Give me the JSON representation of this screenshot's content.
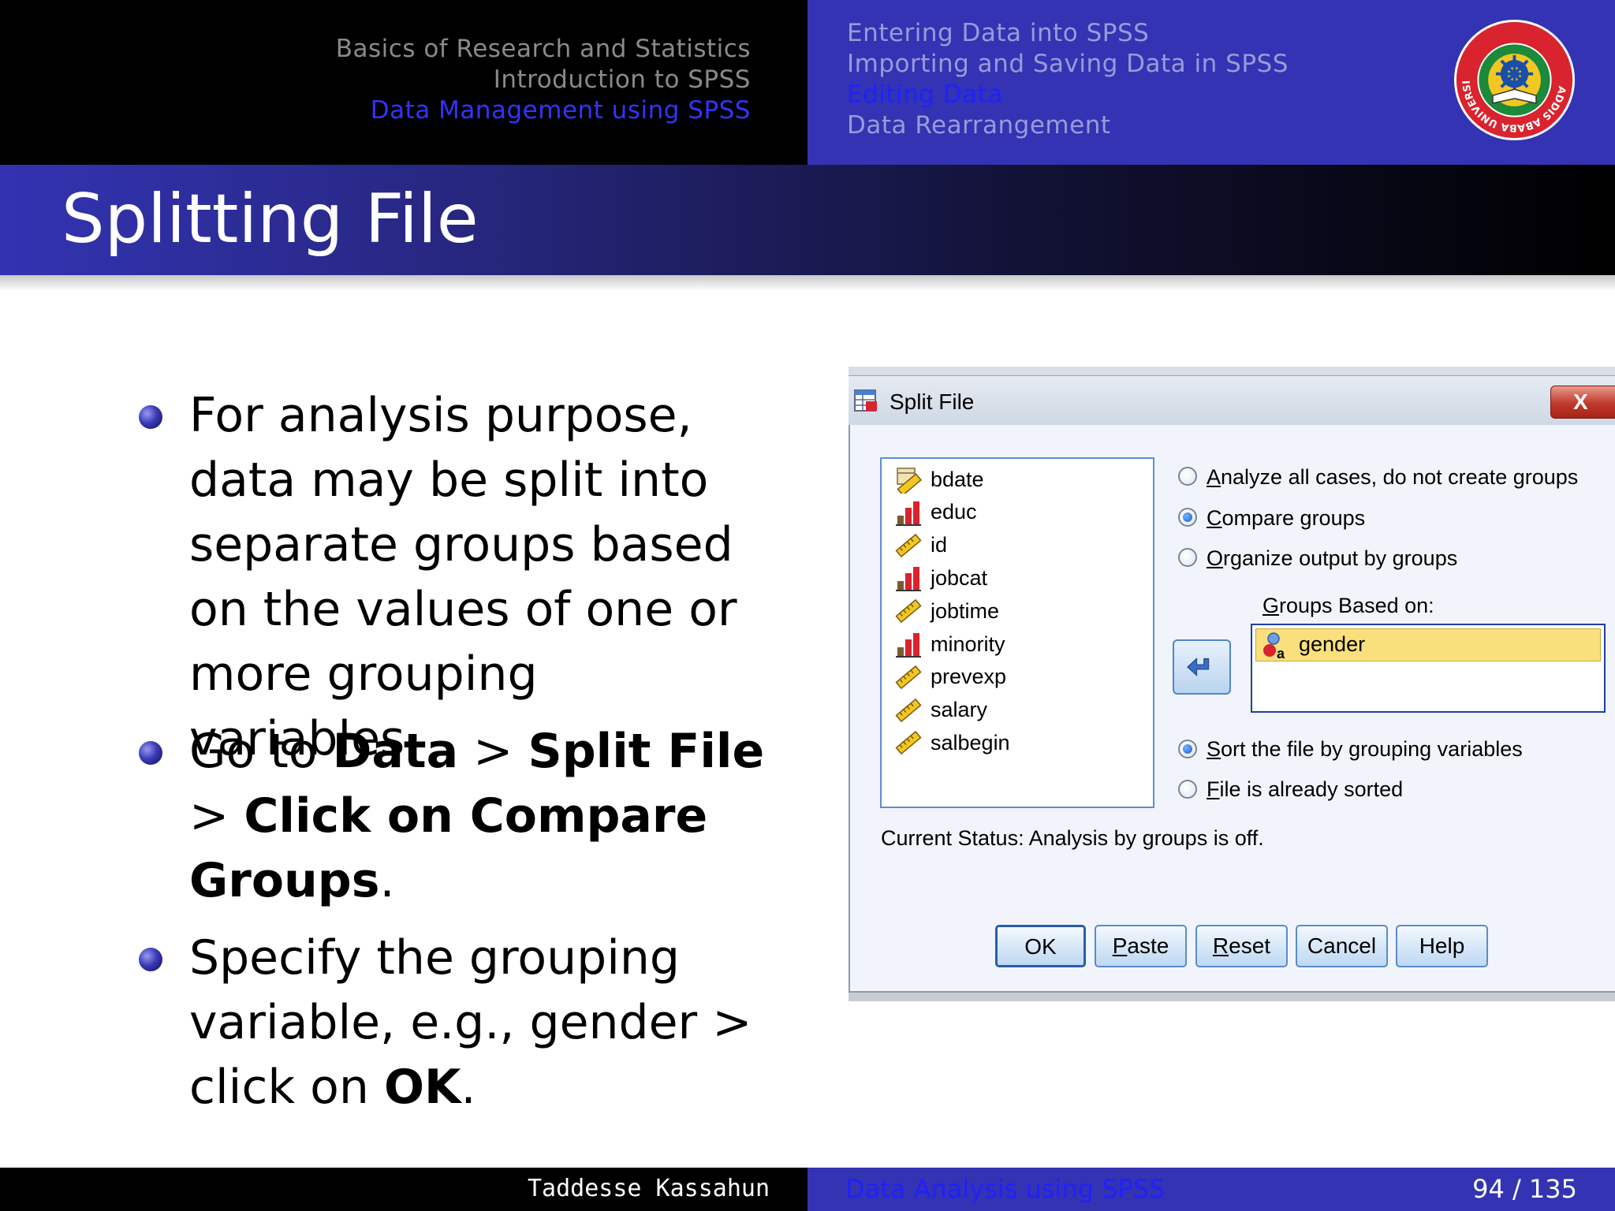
{
  "header": {
    "sections": [
      {
        "label": "Basics of Research and Statistics",
        "active": false
      },
      {
        "label": "Introduction to SPSS",
        "active": false
      },
      {
        "label": "Data Management using SPSS",
        "active": true
      }
    ],
    "subsections": [
      {
        "label": "Entering Data into SPSS",
        "active": false
      },
      {
        "label": "Importing and Saving Data in SPSS",
        "active": false
      },
      {
        "label": "Editing Data",
        "active": true
      },
      {
        "label": "Data Rearrangement",
        "active": false
      }
    ],
    "logo": {
      "ring_text": "ADDIS ABABA UNIVERSITY",
      "icon": "addis-ababa-university-seal"
    }
  },
  "frame_title": "Splitting File",
  "bullets": [
    {
      "parts": [
        {
          "text": "For analysis purpose, data may be split into separate groups based on the values of one or more grouping variables.",
          "bold": false
        }
      ]
    },
    {
      "parts": [
        {
          "text": "Go to ",
          "bold": false
        },
        {
          "text": "Data",
          "bold": true
        },
        {
          "text": " > ",
          "bold": false
        },
        {
          "text": "Split File",
          "bold": true
        },
        {
          "text": " > ",
          "bold": false
        },
        {
          "text": "Click on Compare Groups",
          "bold": true
        },
        {
          "text": ".",
          "bold": false
        }
      ]
    },
    {
      "parts": [
        {
          "text": "Specify the grouping variable, e.g., gender > click on ",
          "bold": false
        },
        {
          "text": "OK",
          "bold": true
        },
        {
          "text": ".",
          "bold": false
        }
      ]
    }
  ],
  "dialog": {
    "title": "Split File",
    "close_label": "X",
    "variables": [
      {
        "label": "bdate",
        "icon": "date-scale-icon"
      },
      {
        "label": "educ",
        "icon": "ordinal-icon"
      },
      {
        "label": "id",
        "icon": "scale-ruler-icon"
      },
      {
        "label": "jobcat",
        "icon": "ordinal-icon"
      },
      {
        "label": "jobtime",
        "icon": "scale-ruler-icon"
      },
      {
        "label": "minority",
        "icon": "ordinal-icon"
      },
      {
        "label": "prevexp",
        "icon": "scale-ruler-icon"
      },
      {
        "label": "salary",
        "icon": "scale-ruler-icon"
      },
      {
        "label": "salbegin",
        "icon": "scale-ruler-icon"
      }
    ],
    "mode_options": [
      {
        "underline": "A",
        "rest": "nalyze all cases, do not create groups",
        "selected": false
      },
      {
        "underline": "C",
        "rest": "ompare groups",
        "selected": true
      },
      {
        "underline": "O",
        "rest": "rganize output by groups",
        "selected": false
      }
    ],
    "groups_label_underline": "G",
    "groups_label_rest": "roups Based on:",
    "groups": [
      {
        "label": "gender",
        "icon": "nominal-string-icon"
      }
    ],
    "sort_options": [
      {
        "underline": "S",
        "rest": "ort the file by grouping variables",
        "selected": true
      },
      {
        "underline": "F",
        "rest": "ile is already sorted",
        "selected": false
      }
    ],
    "status": "Current Status: Analysis by groups is off.",
    "buttons": {
      "ok": "OK",
      "paste_u": "P",
      "paste_rest": "aste",
      "reset_u": "R",
      "reset_rest": "eset",
      "cancel": "Cancel",
      "help": "Help"
    }
  },
  "footer": {
    "author": "Taddesse Kassahun",
    "title": "Data Analysis using SPSS",
    "page": "94 / 135"
  },
  "colors": {
    "beamer_blue": "#3333b3",
    "active_link": "#3333ff",
    "inactive_gray": "#8a8a8a",
    "selected_group": "#f9e07c",
    "dialog_bg": "#f1f5fb"
  }
}
